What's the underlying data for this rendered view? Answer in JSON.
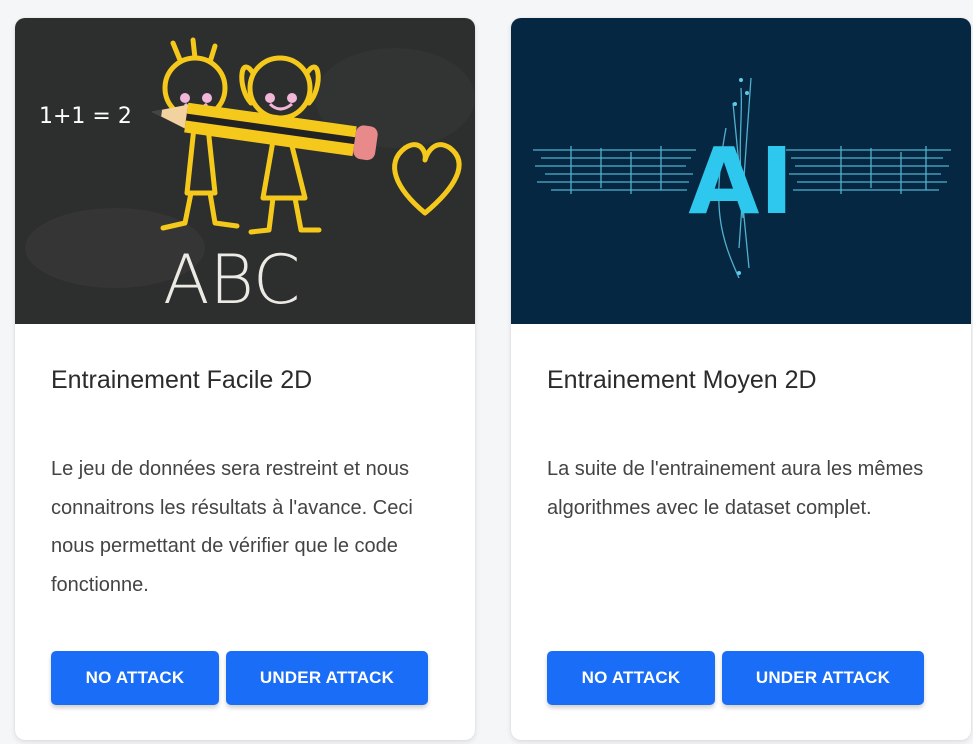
{
  "cards": [
    {
      "title": "Entrainement Facile 2D",
      "description": "Le jeu de données sera restreint et nous connaitrons les résultats à l'avance. Ceci nous permettant de vérifier que le code fonctionne.",
      "image": {
        "text_equation": "1+1 = 2",
        "text_letters": "ABC",
        "colors": {
          "board": "#2d2e2e",
          "chalk_yellow": "#f5c91c",
          "chalk_pink": "#f2b6d9",
          "chalk_white": "#eceae4"
        }
      },
      "buttons": {
        "no_attack": "NO ATTACK",
        "under_attack": "UNDER ATTACK"
      }
    },
    {
      "title": "Entrainement Moyen 2D",
      "description": "La suite de l'entrainement aura les mêmes algorithmes avec le dataset complet.",
      "image": {
        "logo_text": "AI",
        "colors": {
          "background": "#052742",
          "circuit": "#5fc9e6",
          "logo": "#2ec8ee"
        }
      },
      "buttons": {
        "no_attack": "NO ATTACK",
        "under_attack": "UNDER ATTACK"
      }
    }
  ],
  "theme": {
    "button_bg": "#1a6df7",
    "button_text": "#ffffff",
    "title_color": "#2b2b2b",
    "text_color": "#444444"
  }
}
